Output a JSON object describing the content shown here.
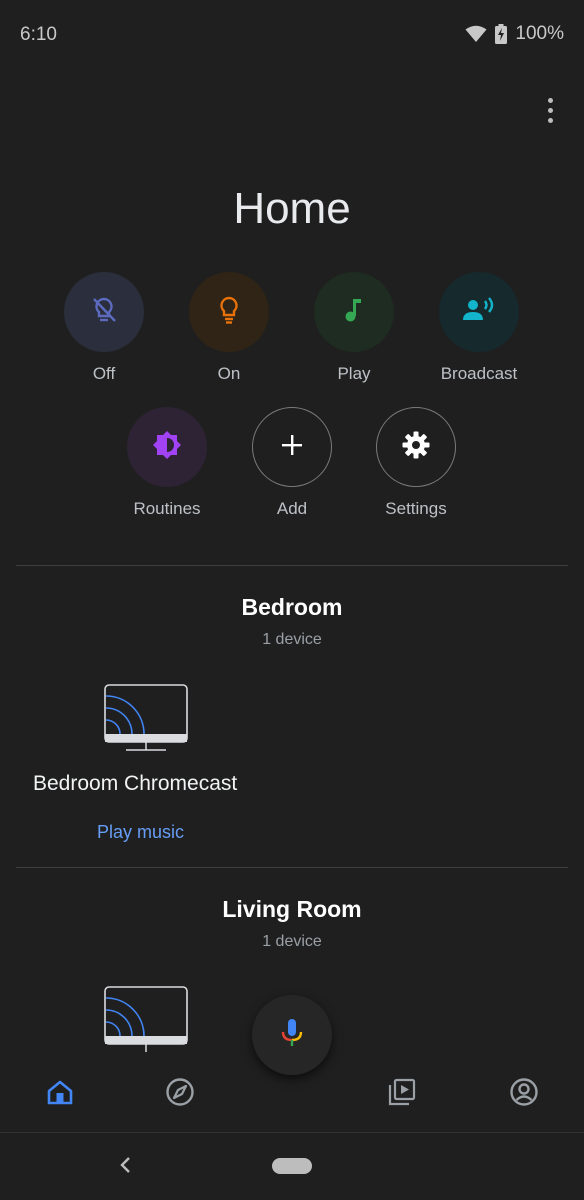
{
  "status_bar": {
    "time": "6:10",
    "battery": "100%"
  },
  "header": {
    "title": "Home"
  },
  "quick_actions": [
    {
      "label": "Off",
      "icon": "light-off-icon",
      "color": "#5c6bc0"
    },
    {
      "label": "On",
      "icon": "lightbulb-icon",
      "color": "#e8710a"
    },
    {
      "label": "Play",
      "icon": "music-note-icon",
      "color": "#34a853"
    },
    {
      "label": "Broadcast",
      "icon": "broadcast-icon",
      "color": "#12b5cb"
    },
    {
      "label": "Routines",
      "icon": "routines-icon",
      "color": "#a142f4"
    },
    {
      "label": "Add",
      "icon": "plus-icon",
      "color": "#ffffff"
    },
    {
      "label": "Settings",
      "icon": "gear-icon",
      "color": "#ffffff"
    }
  ],
  "rooms": [
    {
      "name": "Bedroom",
      "count": "1 device",
      "device": {
        "name": "Bedroom Chromecast",
        "icon": "chromecast-tv-icon",
        "action": "Play music"
      }
    },
    {
      "name": "Living Room",
      "count": "1 device",
      "device": {
        "icon": "chromecast-tv-icon"
      }
    }
  ],
  "bottom_nav": [
    {
      "name": "home",
      "icon": "home-icon",
      "active": true
    },
    {
      "name": "discover",
      "icon": "compass-icon",
      "active": false
    },
    {
      "name": "media",
      "icon": "media-library-icon",
      "active": false
    },
    {
      "name": "account",
      "icon": "account-icon",
      "active": false
    }
  ],
  "colors": {
    "accent": "#669df6",
    "background": "#1f1f1f"
  }
}
